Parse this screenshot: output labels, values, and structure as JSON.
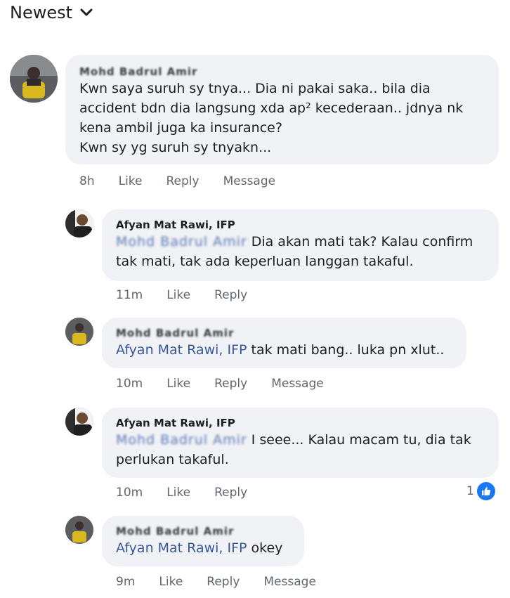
{
  "sort": {
    "label": "Newest",
    "icon": "chevron-down-icon"
  },
  "comments": [
    {
      "author": "Mohd Badrul Amir",
      "text": [
        "Kwn saya suruh sy tnya... Dia ni pakai saka.. bila dia",
        "accident bdn dia langsung xda ap² kecederaan.. jdnya nk",
        "kena ambil juga ka insurance?",
        "Kwn sy yg suruh sy tnyakn..."
      ],
      "time": "8h",
      "like": "Like",
      "reply": "Reply",
      "message": "Message"
    },
    {
      "author": "Afyan Mat Rawi, IFP",
      "mention": "Mohd Badrul Amir",
      "text_first": " Dia akan mati tak? Kalau confirm",
      "text_rest": "tak mati, tak ada keperluan langgan takaful.",
      "time": "11m",
      "like": "Like",
      "reply": "Reply"
    },
    {
      "author": "Mohd Badrul Amir",
      "mention": "Afyan Mat Rawi, IFP",
      "text": " tak mati bang.. luka pn xlut..",
      "time": "10m",
      "like": "Like",
      "reply": "Reply",
      "message": "Message"
    },
    {
      "author": "Afyan Mat Rawi, IFP",
      "mention": "Mohd Badrul Amir",
      "text_first": " I seee... Kalau macam tu, dia tak",
      "text_rest": "perlukan takaful.",
      "time": "10m",
      "like": "Like",
      "reply": "Reply",
      "reaction_count": "1"
    },
    {
      "author": "Mohd Badrul Amir",
      "mention": "Afyan Mat Rawi, IFP",
      "text": " okey",
      "time": "9m",
      "like": "Like",
      "reply": "Reply",
      "message": "Message"
    }
  ]
}
